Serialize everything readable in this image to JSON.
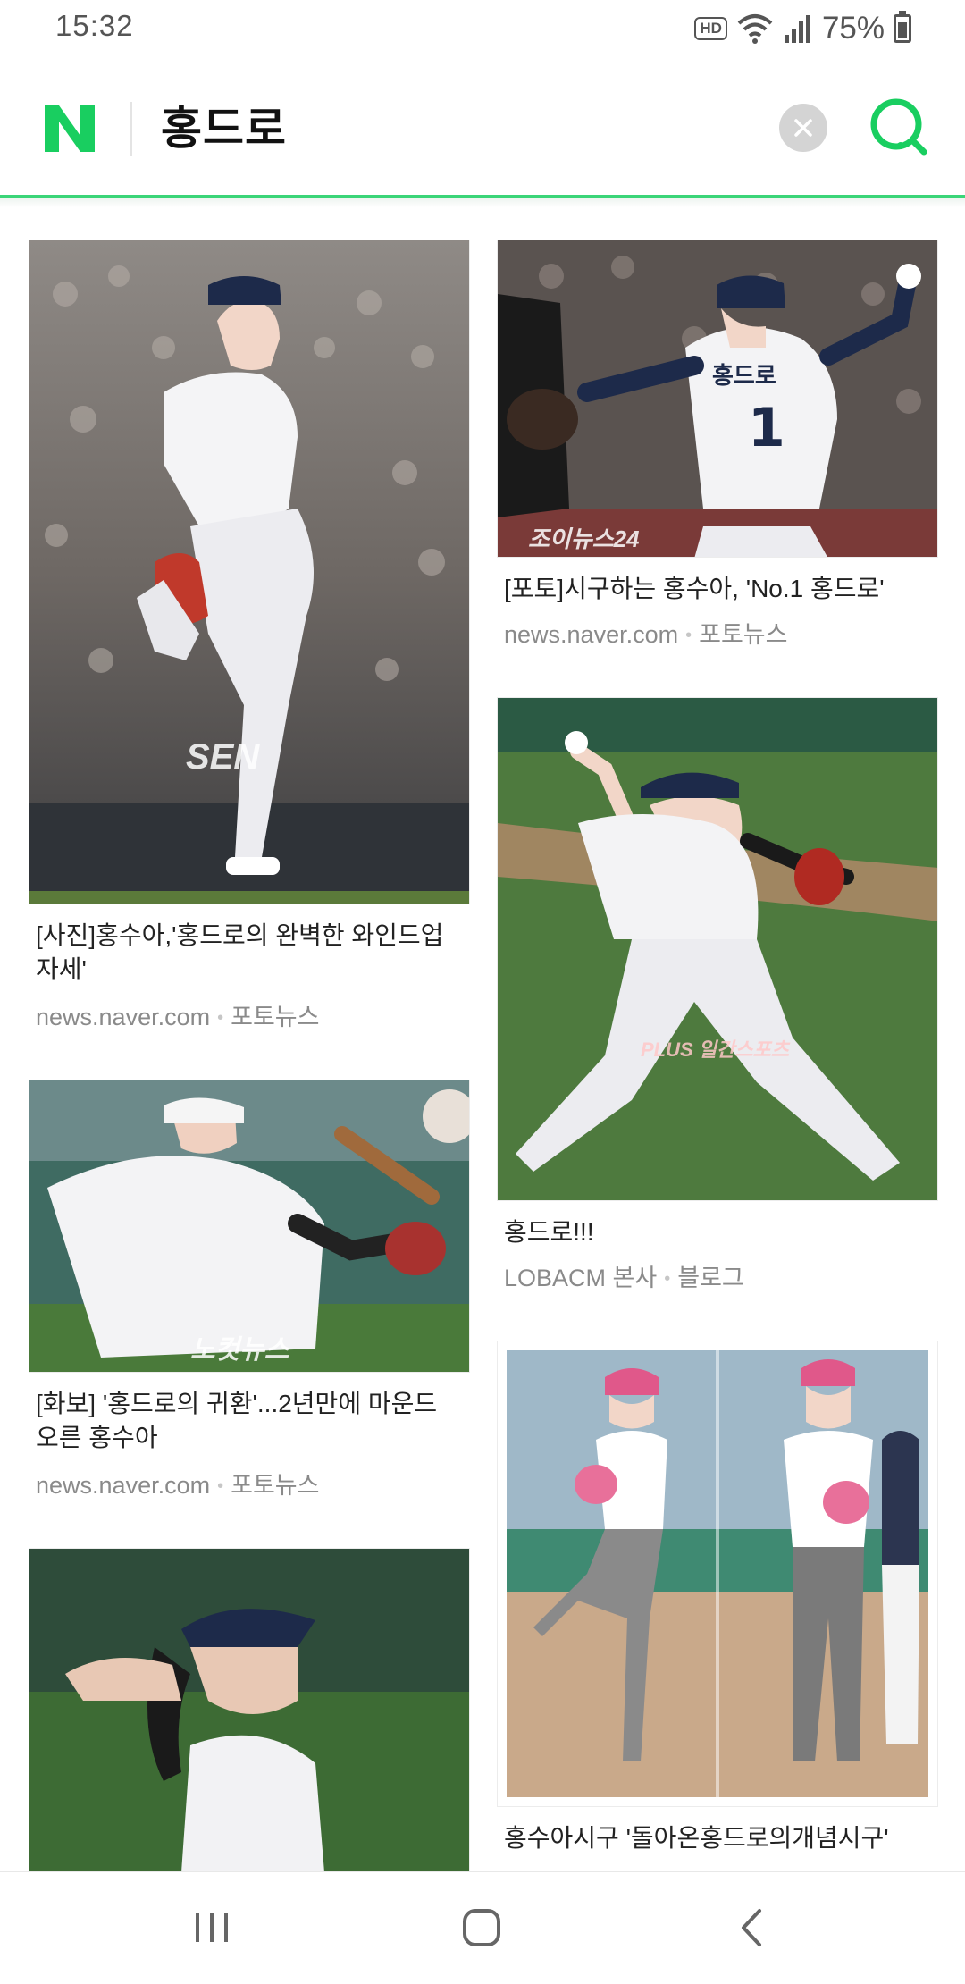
{
  "status_bar": {
    "time": "15:32",
    "hd": "HD",
    "battery": "75%",
    "icons": [
      "wifi-icon",
      "signal-icon",
      "battery-icon"
    ]
  },
  "search": {
    "logo": "N",
    "query": "홍드로",
    "clear_icon": "close-icon",
    "search_icon": "search-icon",
    "accent_color": "#19ce60"
  },
  "results": {
    "left": [
      {
        "caption": "[사진]홍수아,'홍드로의 완벽한 와인드업 자세'",
        "source": "news.naver.com",
        "category": "포토뉴스",
        "watermark": "SEN"
      },
      {
        "caption": "[화보] '홍드로의 귀환'...2년만에 마운드 오른 홍수아",
        "source": "news.naver.com",
        "category": "포토뉴스",
        "watermark": "노컷뉴스"
      },
      {
        "caption": "",
        "source": "",
        "category": ""
      }
    ],
    "right": [
      {
        "caption": "[포토]시구하는 홍수아, 'No.1 홍드로'",
        "source": "news.naver.com",
        "category": "포토뉴스",
        "watermark": "조이뉴스24",
        "jersey_name": "홍드로",
        "jersey_number": "1"
      },
      {
        "caption": "홍드로!!!",
        "source": "LOBACM 본사",
        "category": "블로그",
        "watermark": "PLUS 일간스포츠"
      },
      {
        "caption": "홍수아시구 '돌아온홍드로의개념시구'",
        "source": "",
        "category": ""
      }
    ]
  },
  "nav": {
    "recent_icon": "recent-apps-icon",
    "home_icon": "home-icon",
    "back_icon": "back-icon"
  }
}
